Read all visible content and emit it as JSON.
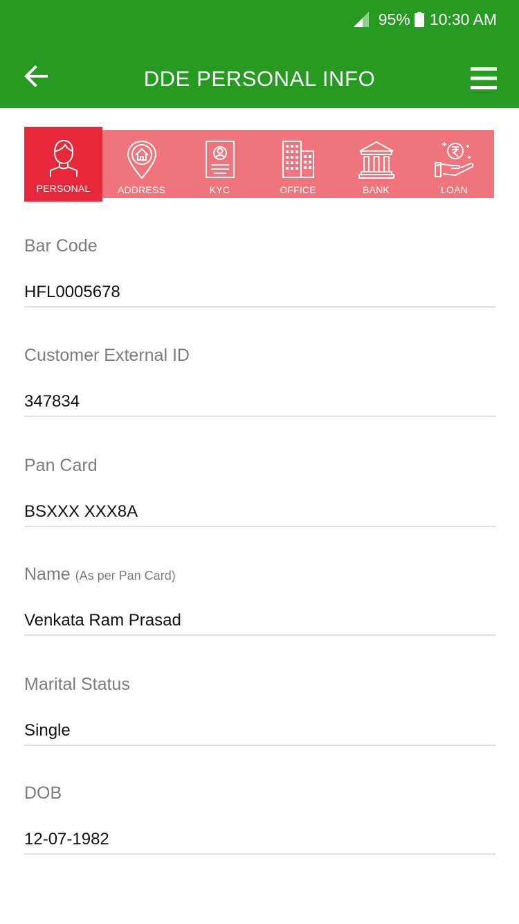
{
  "status_bar": {
    "battery": "95%",
    "time": "10:30 AM"
  },
  "header": {
    "title": "DDE PERSONAL INFO"
  },
  "colors": {
    "appbar": "#279a22",
    "tab_bar": "#f0747c",
    "tab_active": "#e6283a"
  },
  "tabs": [
    {
      "label": "PERSONAL",
      "icon": "person-icon",
      "active": true
    },
    {
      "label": "ADDRESS",
      "icon": "location-pin-icon"
    },
    {
      "label": "KYC",
      "icon": "id-card-icon"
    },
    {
      "label": "OFFICE",
      "icon": "office-building-icon"
    },
    {
      "label": "BANK",
      "icon": "bank-icon"
    },
    {
      "label": "LOAN",
      "icon": "rupee-hand-icon"
    }
  ],
  "fields": {
    "bar_code": {
      "label": "Bar Code",
      "value": "HFL0005678"
    },
    "customer_external_id": {
      "label": "Customer External ID",
      "value": "347834"
    },
    "pan_card": {
      "label": "Pan Card",
      "value": "BSXXX XXX8A"
    },
    "name": {
      "label": "Name",
      "sublabel": "(As per Pan Card)",
      "value": "Venkata Ram Prasad"
    },
    "marital_status": {
      "label": "Marital Status",
      "value": "Single"
    },
    "dob": {
      "label": "DOB",
      "value": "12-07-1982"
    }
  }
}
